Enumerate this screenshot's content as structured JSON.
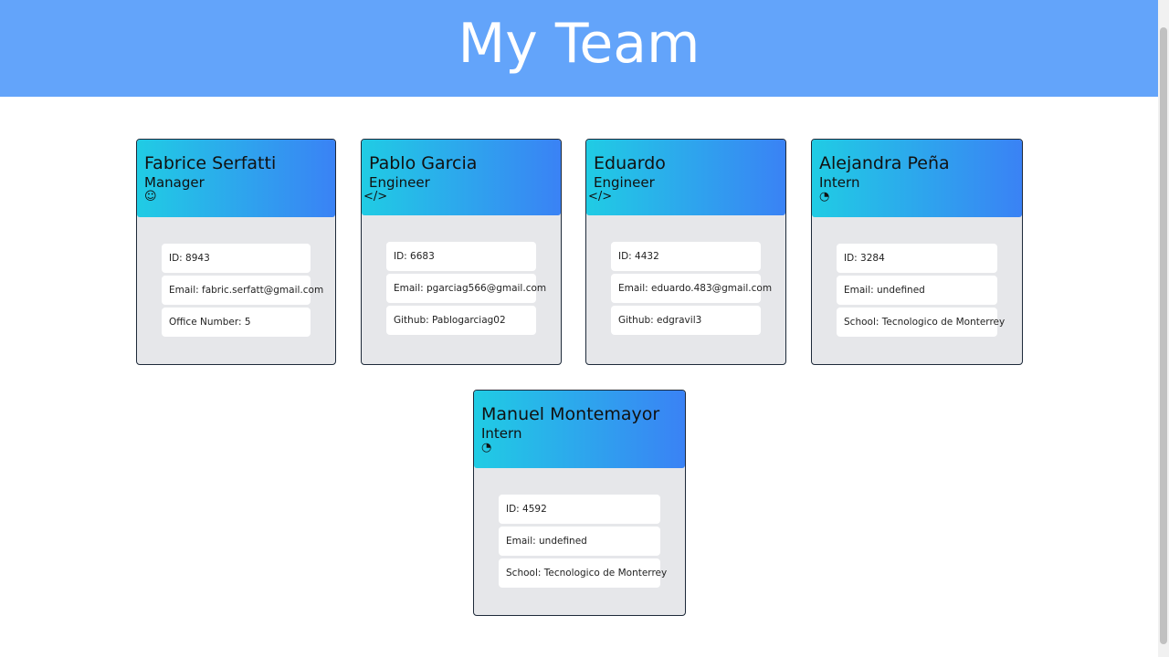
{
  "page": {
    "title": "My Team"
  },
  "cards": [
    {
      "name": "Fabrice Serfatti",
      "role": "Manager",
      "icon": "☺",
      "icon_name": "coffee-mug-icon",
      "fields": [
        "ID: 8943",
        "Email: fabric.serfatt@gmail.com",
        "Office Number: 5"
      ]
    },
    {
      "name": "Pablo Garcia",
      "role": "Engineer",
      "icon": "</>",
      "icon_name": "code-icon",
      "fields": [
        "ID: 6683",
        "Email: pgarciag566@gmail.com",
        "Github: Pablogarciag02"
      ]
    },
    {
      "name": "Eduardo",
      "role": "Engineer",
      "icon": "</>",
      "icon_name": "code-icon",
      "fields": [
        "ID: 4432",
        "Email: eduardo.483@gmail.com",
        "Github: edgravil3"
      ]
    },
    {
      "name": "Alejandra Peña",
      "role": "Intern",
      "icon": "◔",
      "icon_name": "student-icon",
      "fields": [
        "ID: 3284",
        "Email: undefined",
        "School: Tecnologico de Monterrey"
      ]
    },
    {
      "name": "Manuel Montemayor",
      "role": "Intern",
      "icon": "◔",
      "icon_name": "student-icon",
      "fields": [
        "ID: 4592",
        "Email: undefined",
        "School: Tecnologico de Monterrey"
      ]
    }
  ]
}
